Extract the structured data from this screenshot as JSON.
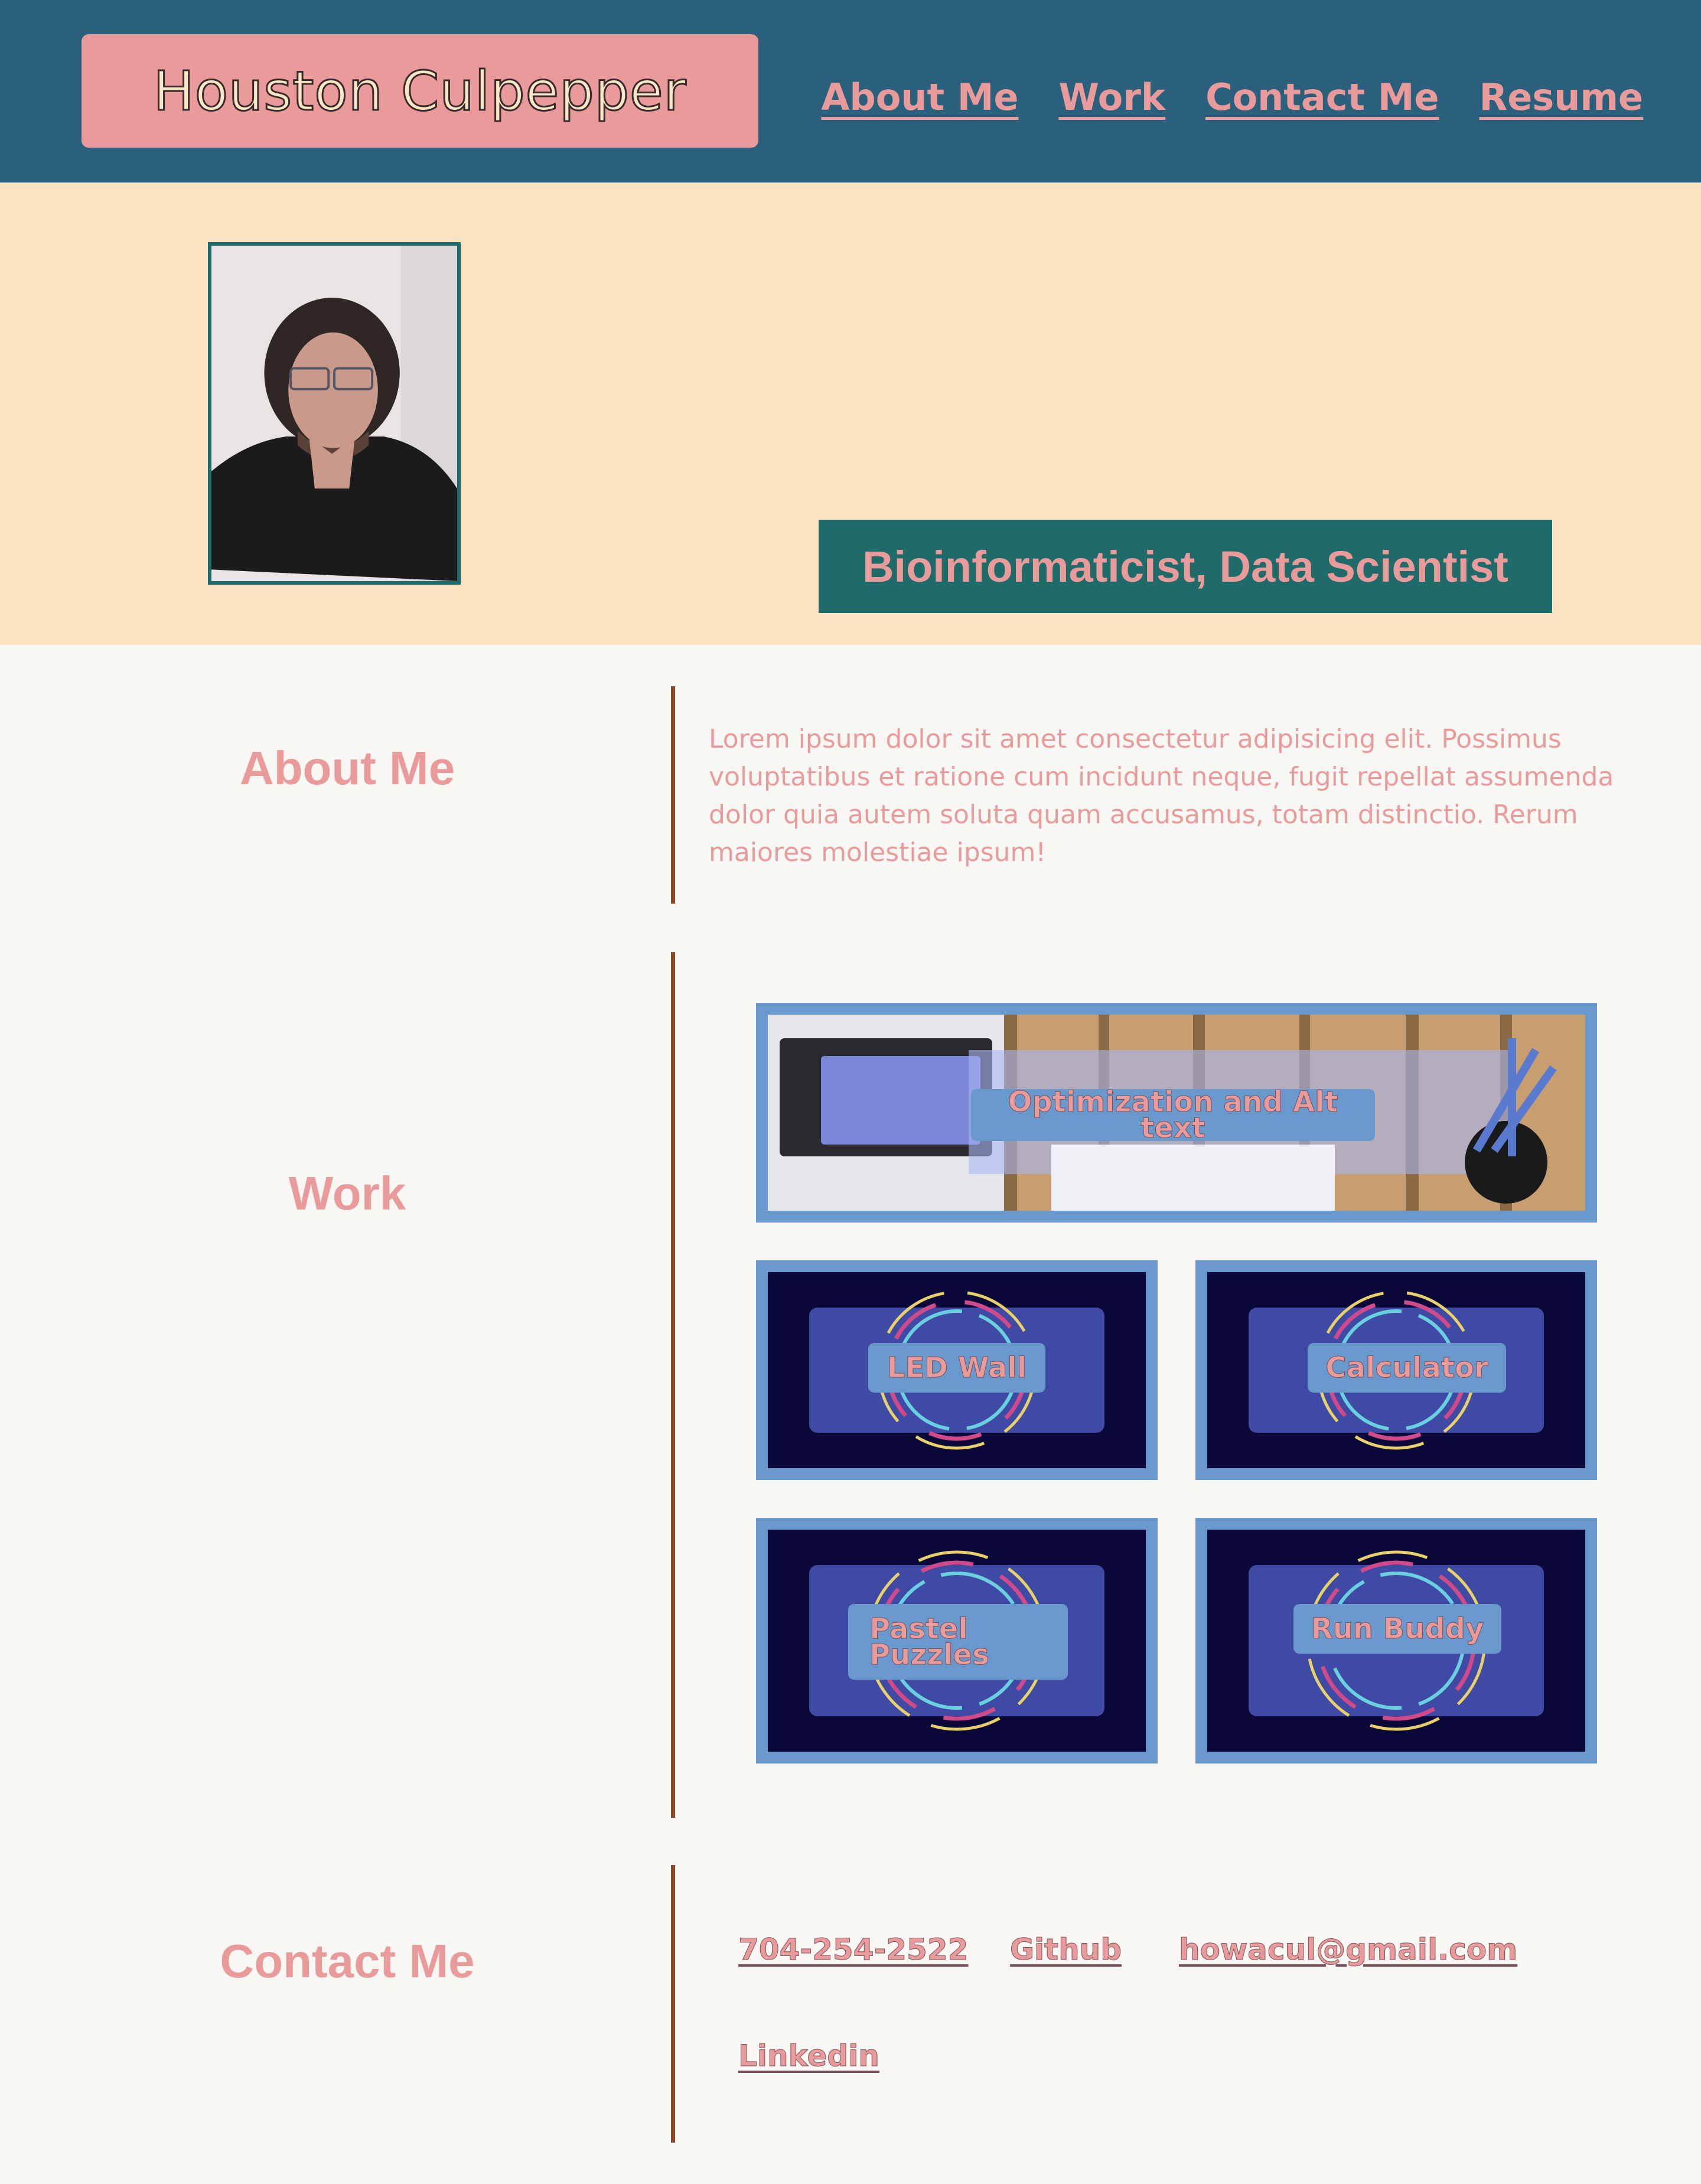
{
  "header": {
    "name": "Houston Culpepper",
    "nav": [
      "About Me",
      "Work",
      "Contact Me",
      "Resume"
    ]
  },
  "hero": {
    "title": "Bioinformaticist, Data Scientist"
  },
  "about": {
    "heading": "About Me",
    "text": "Lorem ipsum dolor sit amet consectetur adipisicing elit. Possimus voluptatibus et ratione cum incidunt neque, fugit repellat assumenda dolor quia autem soluta quam accusamus, totam distinctio. Rerum maiores molestiae ipsum!"
  },
  "work": {
    "heading": "Work",
    "projects": [
      {
        "label": "Optimization and Alt text"
      },
      {
        "label": "LED Wall"
      },
      {
        "label": "Calculator"
      },
      {
        "label": "Pastel Puzzles"
      },
      {
        "label": "Run Buddy"
      }
    ]
  },
  "contact": {
    "heading": "Contact Me",
    "phone": "704-254-2522",
    "github": "Github",
    "email": "howacul@gmail.com",
    "linkedin": "Linkedin"
  },
  "colors": {
    "header_bg": "#2b607d",
    "accent_pink": "#e99a9a",
    "hero_bg": "#fde3c1",
    "teal": "#1e6b6a",
    "card_border": "#6998cc",
    "divider": "#8b4a23"
  }
}
